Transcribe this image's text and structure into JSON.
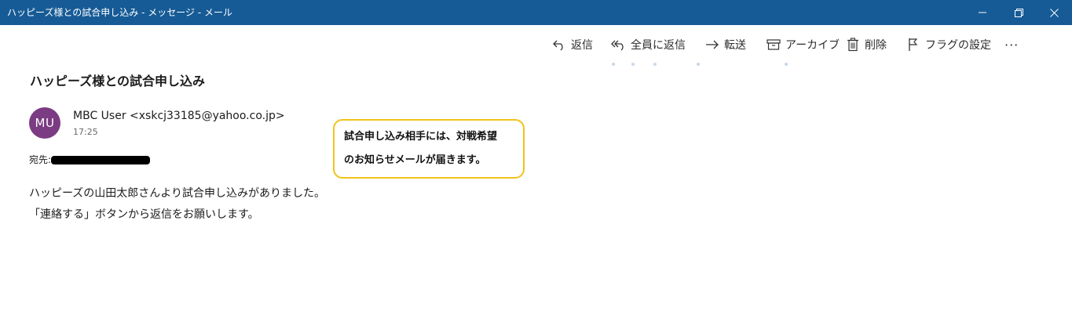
{
  "window": {
    "title": "ハッピーズ様との試合申し込み - メッセージ - メール"
  },
  "toolbar": {
    "reply": "返信",
    "reply_all": "全員に返信",
    "forward": "転送",
    "archive": "アーカイブ",
    "delete": "削除",
    "flag": "フラグの設定",
    "more": "···"
  },
  "message": {
    "subject": "ハッピーズ様との試合申し込み",
    "avatar_initials": "MU",
    "avatar_color": "#7b3c83",
    "sender": "MBC User <xskcj33185@yahoo.co.jp>",
    "time": "17:25",
    "to_label": "宛先:",
    "body": [
      "ハッピーズの山田太郎さんより試合申し込みがありました。",
      "「連絡する」ボタンから返信をお願いします。"
    ]
  },
  "callout": {
    "lines": [
      "試合申し込み相手には、対戦希望",
      "のお知らせメールが届きます。"
    ],
    "border_color": "#f2c21b"
  },
  "colors": {
    "titlebar": "#165b96"
  }
}
